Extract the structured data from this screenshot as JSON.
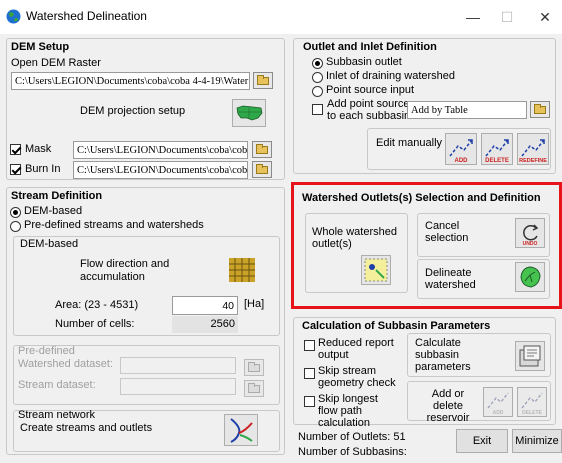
{
  "window": {
    "title": "Watershed Delineation",
    "minimize": "—",
    "maximize": "☐",
    "close": "✕"
  },
  "dem_setup": {
    "title": "DEM Setup",
    "open_label": "Open DEM Raster",
    "raster_path": "C:\\Users\\LEGION\\Documents\\coba\\coba 4-4-19\\Water",
    "projection_label": "DEM projection setup",
    "mask_label": "Mask",
    "mask_path": "C:\\Users\\LEGION\\Documents\\coba\\coba 4",
    "burn_label": "Burn In",
    "burn_path": "C:\\Users\\LEGION\\Documents\\coba\\coba 4"
  },
  "stream_definition": {
    "title": "Stream Definition",
    "opt_dem": "DEM-based",
    "opt_predef": "Pre-defined streams and watersheds",
    "dem_based_title": "DEM-based",
    "flow_label": "Flow direction and accumulation",
    "area_label": "Area: (23 - 4531)",
    "area_value": "40",
    "area_unit": "[Ha]",
    "cells_label": "Number of cells:",
    "cells_value": "2560",
    "predef_title": "Pre-defined",
    "ws_dataset_label": "Watershed dataset:",
    "stream_dataset_label": "Stream dataset:",
    "network_title": "Stream network",
    "network_label": "Create streams and outlets"
  },
  "outlet_inlet": {
    "title": "Outlet and Inlet Definition",
    "opt_subbasin": "Subbasin outlet",
    "opt_inlet": "Inlet of draining watershed",
    "opt_point": "Point source input",
    "add_point_label": "Add point source to each subbasin",
    "add_by_table": "Add by Table",
    "edit_manually": "Edit manually",
    "add_icon_text": "ADD",
    "delete_icon_text": "DELETE",
    "redefine_icon_text": "REDEFINE"
  },
  "outlet_selection": {
    "title": "Watershed Outlets(s) Selection and Definition",
    "whole_label": "Whole watershed outlet(s)",
    "cancel_label": "Cancel selection",
    "delineate_label": "Delineate watershed",
    "undo_text": "UNDO"
  },
  "subbasin_params": {
    "title": "Calculation of Subbasin Parameters",
    "reduced_label": "Reduced report output",
    "skip_stream_label": "Skip stream geometry check",
    "skip_flow_label": "Skip longest flow path calculation",
    "calc_label": "Calculate subbasin parameters",
    "add_reservoir_label": "Add or delete reservoir",
    "add_icon_text": "ADD",
    "delete_icon_text": "DELETE"
  },
  "footer": {
    "outlets": "Number of Outlets: 51",
    "subbasins": "Number of Subbasins:",
    "exit": "Exit",
    "minimize": "Minimize"
  },
  "colors": {
    "highlight": "#e8131a",
    "icon_red": "#cc1f1f",
    "icon_blue": "#1f3fa8"
  }
}
